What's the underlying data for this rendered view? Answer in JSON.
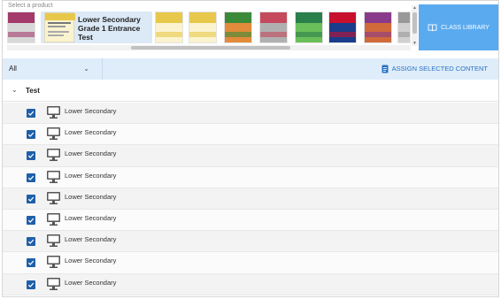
{
  "strip": {
    "label": "Select a product",
    "selected_product_title": "Lower Secondary Grade 1 Entrance Test",
    "thumbnails": [
      {
        "name": "product-thumb-1",
        "colors": [
          "#a33a6b",
          "#d8d8d8"
        ]
      },
      {
        "name": "product-thumb-3",
        "colors": [
          "#e8c84a",
          "#fbf3d0"
        ]
      },
      {
        "name": "product-thumb-4",
        "colors": [
          "#e8c84a",
          "#fbf3d0"
        ]
      },
      {
        "name": "product-thumb-5",
        "colors": [
          "#3a8a3a",
          "#e28b3a"
        ]
      },
      {
        "name": "product-thumb-6",
        "colors": [
          "#c54a5e",
          "#b0b0b0"
        ]
      },
      {
        "name": "product-thumb-7",
        "colors": [
          "#2a7f4a",
          "#6bbf5a"
        ]
      },
      {
        "name": "product-thumb-8",
        "colors": [
          "#c8102e",
          "#1a3c8c"
        ]
      },
      {
        "name": "product-thumb-9",
        "colors": [
          "#8a3a8a",
          "#d06a3a"
        ]
      },
      {
        "name": "product-thumb-10",
        "colors": [
          "#999999",
          "#d0d0d0"
        ]
      }
    ]
  },
  "class_library": {
    "label": "CLASS LIBRARY",
    "icon": "book-open-icon"
  },
  "filter": {
    "value": "All",
    "icon": "chevron-down-icon"
  },
  "assign": {
    "label": "ASSIGN SELECTED CONTENT",
    "icon": "document-icon"
  },
  "group": {
    "title": "Test",
    "icon": "chevron-down-icon"
  },
  "rows": [
    {
      "label": "Lower Secondary",
      "checked": true
    },
    {
      "label": "Lower Secondary",
      "checked": true
    },
    {
      "label": "Lower Secondary",
      "checked": true
    },
    {
      "label": "Lower Secondary",
      "checked": true
    },
    {
      "label": "Lower Secondary",
      "checked": true
    },
    {
      "label": "Lower Secondary",
      "checked": true
    },
    {
      "label": "Lower Secondary",
      "checked": true
    },
    {
      "label": "Lower Secondary",
      "checked": true
    },
    {
      "label": "Lower Secondary",
      "checked": true
    }
  ],
  "colors": {
    "accent": "#5aaaf0",
    "checkbox": "#1f5fa8",
    "filter_bg": "#dfedfa",
    "selected_bg": "#dce9f6"
  }
}
